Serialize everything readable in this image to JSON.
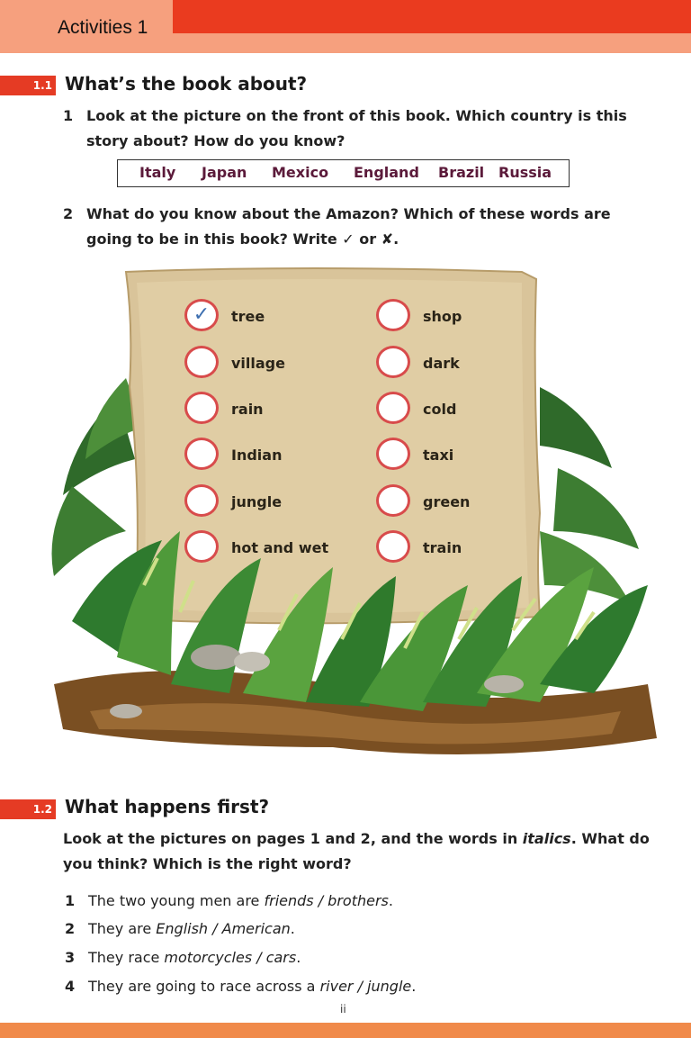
{
  "header": {
    "title": "Activities 1"
  },
  "section1": {
    "badge": "1.1",
    "title": "What’s the book about?",
    "q1": {
      "num": "1",
      "line1": "Look at the picture on the front of this book. Which country is this",
      "line2": "story about? How do you know?"
    },
    "countries": [
      "Italy",
      "Japan",
      "Mexico",
      "England",
      "Brazil",
      "Russia"
    ],
    "q2": {
      "num": "2",
      "line1": "What do you know about the Amazon? Which of these words are",
      "line2": "going to be in this book? Write ✓ or ✘."
    },
    "words_left": [
      {
        "word": "tree",
        "mark": "✓"
      },
      {
        "word": "village",
        "mark": ""
      },
      {
        "word": "rain",
        "mark": ""
      },
      {
        "word": "Indian",
        "mark": ""
      },
      {
        "word": "jungle",
        "mark": ""
      },
      {
        "word": "hot and wet",
        "mark": ""
      }
    ],
    "words_right": [
      {
        "word": "shop",
        "mark": ""
      },
      {
        "word": "dark",
        "mark": ""
      },
      {
        "word": "cold",
        "mark": ""
      },
      {
        "word": "taxi",
        "mark": ""
      },
      {
        "word": "green",
        "mark": ""
      },
      {
        "word": "train",
        "mark": ""
      }
    ]
  },
  "section2": {
    "badge": "1.2",
    "title": "What happens first?",
    "intro1": "Look at the pictures on pages 1 and 2, and the words in",
    "intro_italic": "italics",
    "intro1_end": ". What do",
    "intro2": "you think? Which is the right word?",
    "items": [
      {
        "n": "1",
        "pre": "The two young men are ",
        "opt": "friends / brothers",
        "post": "."
      },
      {
        "n": "2",
        "pre": "They are ",
        "opt": "English / American",
        "post": "."
      },
      {
        "n": "3",
        "pre": "They race ",
        "opt": "motorcycles / cars",
        "post": "."
      },
      {
        "n": "4",
        "pre": "They are going to race across a ",
        "opt": "river / jungle",
        "post": "."
      }
    ]
  },
  "page_number": "ii",
  "colors": {
    "header_peach": "#f6a07e",
    "header_red": "#ea3b1f",
    "badge_red": "#e53b24",
    "checkbox_red": "#d84b4b"
  }
}
